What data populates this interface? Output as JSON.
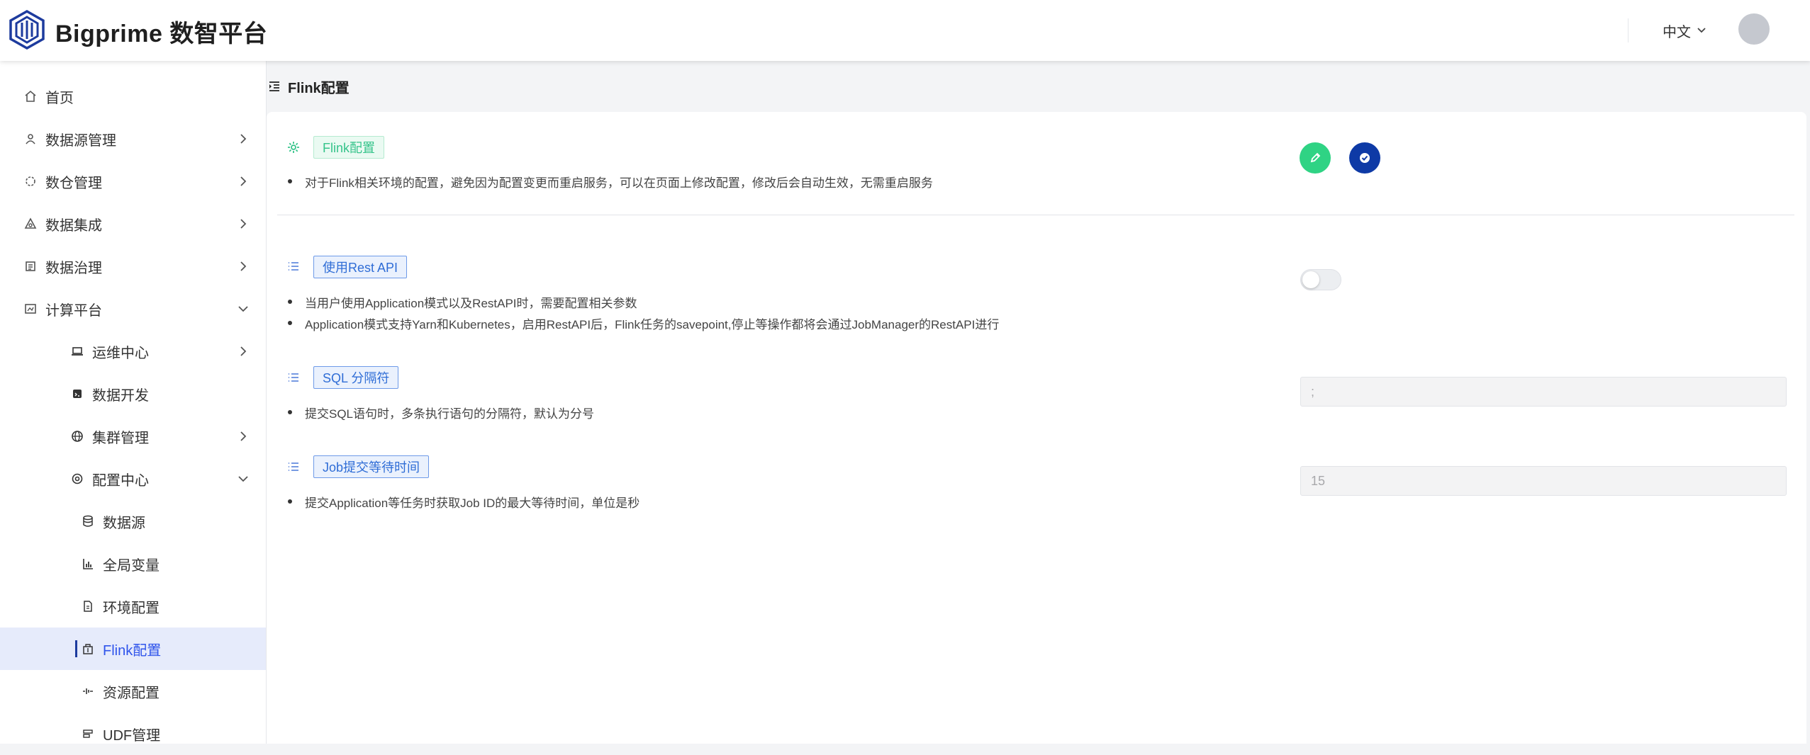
{
  "app": {
    "title": "Bigprime 数智平台"
  },
  "header": {
    "language": "中文"
  },
  "sidebar": {
    "items": [
      {
        "label": "首页",
        "icon": "home-icon"
      },
      {
        "label": "数据源管理",
        "icon": "database-icon"
      },
      {
        "label": "数仓管理",
        "icon": "warehouse-icon"
      },
      {
        "label": "数据集成",
        "icon": "integration-icon"
      },
      {
        "label": "数据治理",
        "icon": "governance-icon"
      },
      {
        "label": "计算平台",
        "icon": "compute-icon"
      },
      {
        "label": "运维中心",
        "icon": "laptop-icon"
      },
      {
        "label": "数据开发",
        "icon": "code-icon"
      },
      {
        "label": "集群管理",
        "icon": "globe-icon"
      },
      {
        "label": "配置中心",
        "icon": "settings-icon"
      },
      {
        "label": "数据源",
        "icon": "datasource-icon"
      },
      {
        "label": "全局变量",
        "icon": "bar-chart-icon"
      },
      {
        "label": "环境配置",
        "icon": "file-icon"
      },
      {
        "label": "Flink配置",
        "icon": "flink-icon"
      },
      {
        "label": "资源配置",
        "icon": "resource-icon"
      },
      {
        "label": "UDF管理",
        "icon": "udf-icon"
      }
    ]
  },
  "breadcrumb": {
    "title": "Flink配置"
  },
  "main": {
    "header_section": {
      "tag": "Flink配置",
      "description": "对于Flink相关环境的配置，避免因为配置变更而重启服务，可以在页面上修改配置，修改后会自动生效，无需重启服务"
    },
    "settings": [
      {
        "tag": "使用Rest API",
        "bullets": [
          "当用户使用Application模式以及RestAPI时，需要配置相关参数",
          "Application模式支持Yarn和Kubernetes，启用RestAPI后，Flink任务的savepoint,停止等操作都将会通过JobManager的RestAPI进行"
        ],
        "control": "toggle",
        "enabled": false
      },
      {
        "tag": "SQL 分隔符",
        "bullets": [
          "提交SQL语句时，多条执行语句的分隔符，默认为分号"
        ],
        "control": "input",
        "value": ";"
      },
      {
        "tag": "Job提交等待时间",
        "bullets": [
          "提交Application等任务时获取Job ID的最大等待时间，单位是秒"
        ],
        "control": "input",
        "value": "15"
      }
    ]
  },
  "colors": {
    "accent": "#2f54eb",
    "edit_button": "#2fd384",
    "save_button": "#0e3aa6",
    "active_menu_bg": "#e6ebfb"
  }
}
